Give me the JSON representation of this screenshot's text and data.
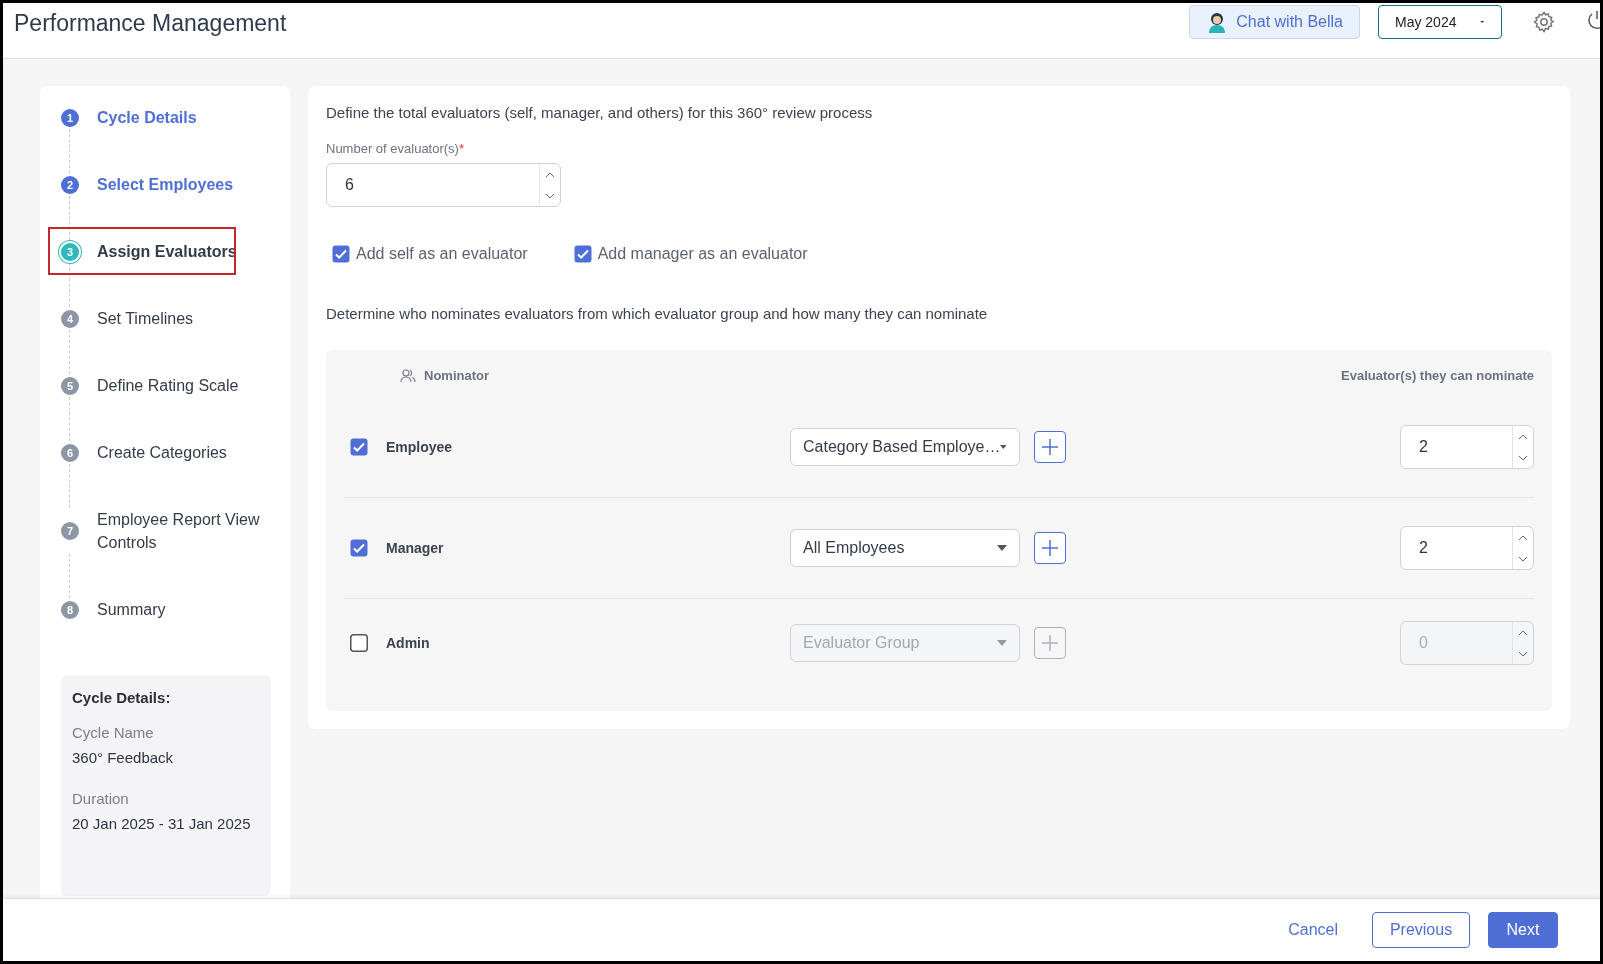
{
  "header": {
    "title": "Performance Management",
    "chat_button": "Chat with Bella",
    "period_select": "May 2024"
  },
  "steps": [
    {
      "number": "1",
      "label": "Cycle Details",
      "completed": true,
      "selected": false,
      "highlighted": false
    },
    {
      "number": "2",
      "label": "Select Employees",
      "completed": true,
      "selected": false,
      "highlighted": false
    },
    {
      "number": "3",
      "label": "Assign Evaluators",
      "completed": false,
      "selected": true,
      "highlighted": true
    },
    {
      "number": "4",
      "label": "Set Timelines",
      "completed": false,
      "selected": false,
      "highlighted": false
    },
    {
      "number": "5",
      "label": "Define Rating Scale",
      "completed": false,
      "selected": false,
      "highlighted": false
    },
    {
      "number": "6",
      "label": "Create Categories",
      "completed": false,
      "selected": false,
      "highlighted": false
    },
    {
      "number": "7",
      "label": "Employee Report View Controls",
      "completed": false,
      "selected": false,
      "highlighted": false
    },
    {
      "number": "8",
      "label": "Summary",
      "completed": false,
      "selected": false,
      "highlighted": false
    }
  ],
  "cycle_summary": {
    "heading": "Cycle Details:",
    "fields": [
      {
        "label": "Cycle Name",
        "value": "360° Feedback"
      },
      {
        "label": "Duration",
        "value": "20 Jan 2025 - 31 Jan 2025"
      }
    ]
  },
  "evaluators": {
    "intro": "Define the total evaluators (self, manager, and others) for this 360° review process",
    "count_label": "Number of evaluator(s)",
    "required_mark": "*",
    "count": "6",
    "options": [
      {
        "label": "Add self as an evaluator",
        "checked": true
      },
      {
        "label": "Add manager as an evaluator",
        "checked": true
      }
    ]
  },
  "nomination": {
    "intro": "Determine who nominates evaluators from which evaluator group and how many they can nominate",
    "columns": [
      "Nominator",
      "Evaluator(s) they can nominate"
    ],
    "rows": [
      {
        "name": "Employee",
        "checked": true,
        "disabled": false,
        "group": "Category Based Employe…",
        "count": "2"
      },
      {
        "name": "Manager",
        "checked": true,
        "disabled": false,
        "group": "All Employees",
        "count": "2"
      },
      {
        "name": "Admin",
        "checked": false,
        "disabled": true,
        "group_placeholder": "Evaluator Group",
        "count": "0"
      }
    ]
  },
  "footer": {
    "buttons": [
      {
        "label": "Cancel",
        "kind": "link"
      },
      {
        "label": "Previous",
        "kind": "outline"
      },
      {
        "label": "Next",
        "kind": "primary"
      }
    ]
  }
}
